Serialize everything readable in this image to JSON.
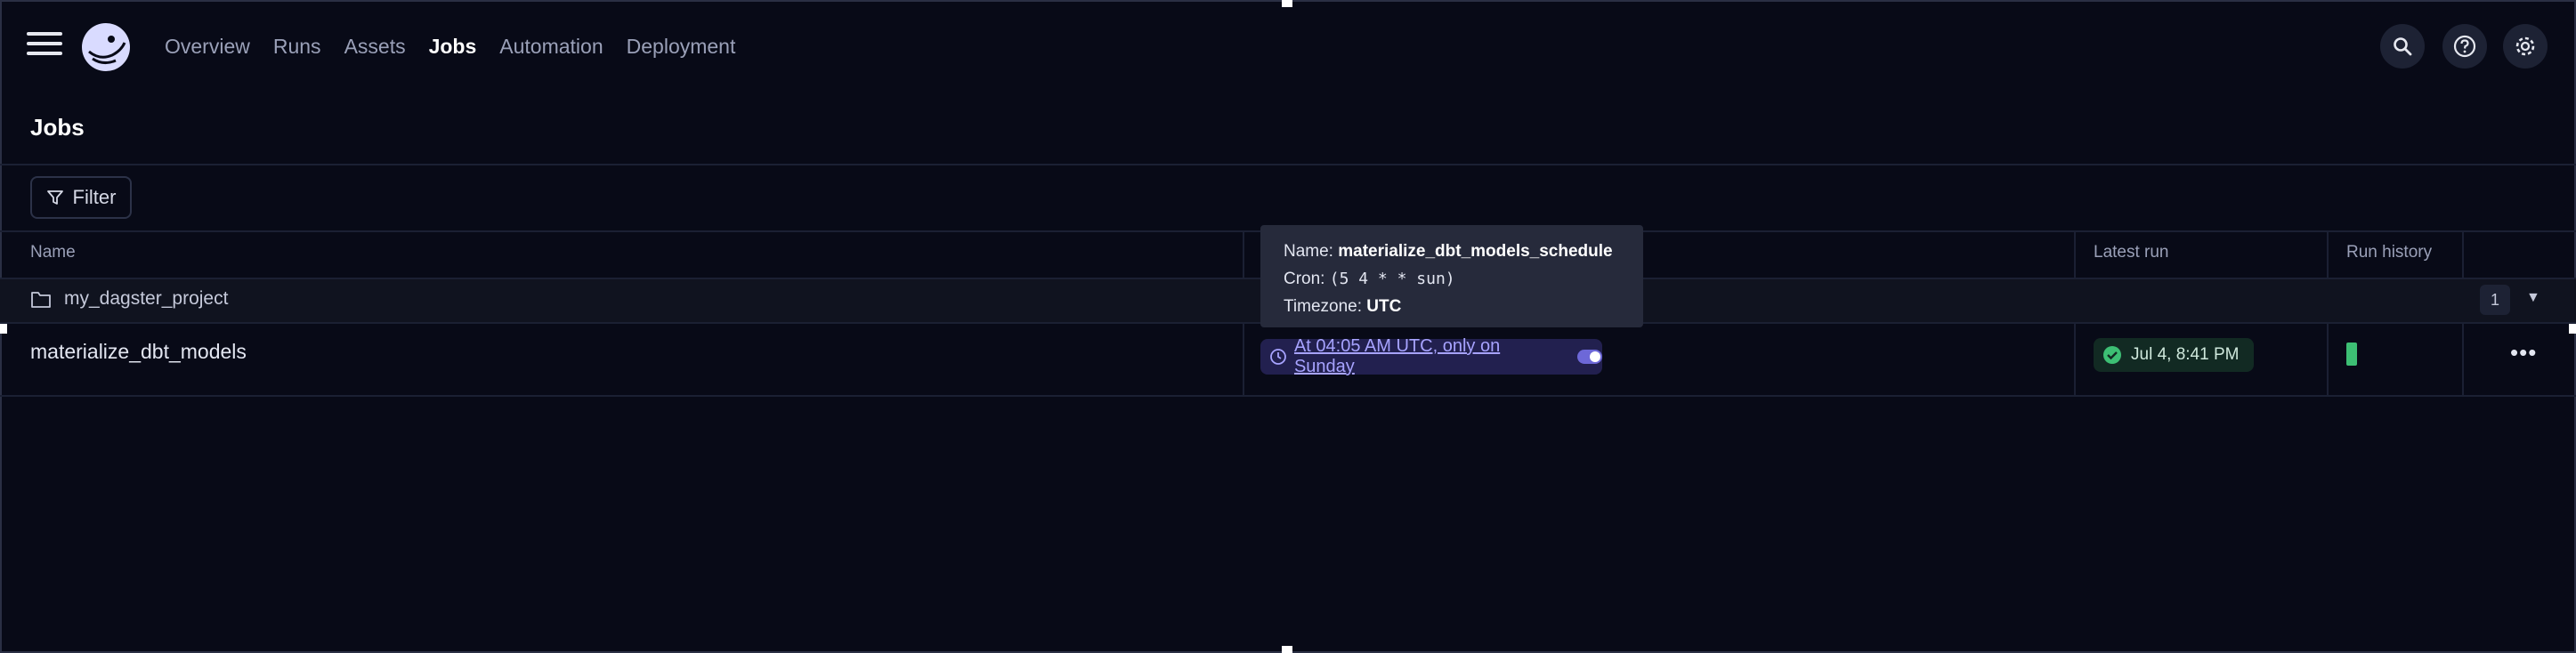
{
  "nav": {
    "links": [
      "Overview",
      "Runs",
      "Assets",
      "Jobs",
      "Automation",
      "Deployment"
    ],
    "active": "Jobs"
  },
  "page": {
    "title": "Jobs"
  },
  "toolbar": {
    "filter_label": "Filter"
  },
  "table": {
    "headers": {
      "name": "Name",
      "latest_run": "Latest run",
      "run_history": "Run history"
    },
    "group": {
      "name": "my_dagster_project",
      "count": "1"
    },
    "rows": [
      {
        "name": "materialize_dbt_models",
        "schedule": "At 04:05 AM UTC, only on Sunday",
        "latest_run": "Jul 4, 8:41 PM"
      }
    ]
  },
  "tooltip": {
    "name_label": "Name:",
    "name_value": "materialize_dbt_models_schedule",
    "cron_label": "Cron:",
    "cron_value": "(5 4 * * sun)",
    "tz_label": "Timezone:",
    "tz_value": "UTC"
  },
  "colors": {
    "background": "#080a17",
    "accent": "#a7a3ff",
    "success": "#3dbf74"
  },
  "icons": [
    "menu-icon",
    "dagster-logo",
    "search-icon",
    "help-icon",
    "gear-icon",
    "filter-icon",
    "folder-icon",
    "chevron-down-icon",
    "clock-icon",
    "check-circle-icon",
    "more-icon"
  ]
}
